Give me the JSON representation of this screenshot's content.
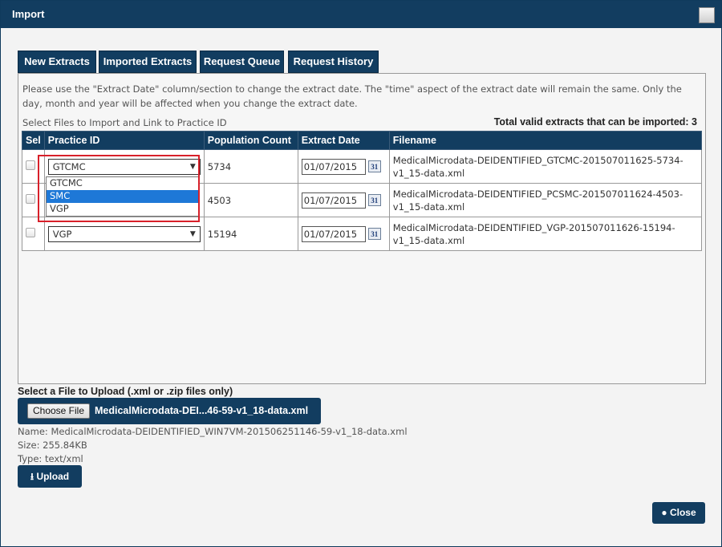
{
  "dialog": {
    "title": "Import"
  },
  "tabs": [
    {
      "label": "New Extracts",
      "active": true
    },
    {
      "label": "Imported Extracts"
    },
    {
      "label": "Request Queue"
    },
    {
      "label": "Request History"
    }
  ],
  "note": "Please use the \"Extract Date\" column/section to change the extract date. The \"time\" aspect of the extract date will remain the same. Only the day, month and year will be affected when you change the extract date.",
  "select_label": "Select Files to Import and Link to Practice ID",
  "total_valid": "Total valid extracts that can be imported: 3",
  "table": {
    "headers": [
      "Sel",
      "Practice ID",
      "Population Count",
      "Extract Date",
      "Filename"
    ],
    "rows": [
      {
        "practice": "GTCMC",
        "population": "5734",
        "date": "01/07/2015",
        "filename": "MedicalMicrodata-DEIDENTIFIED_GTCMC-201507011625-5734-v1_15-data.xml"
      },
      {
        "practice": "",
        "population": "4503",
        "date": "01/07/2015",
        "filename": "MedicalMicrodata-DEIDENTIFIED_PCSMC-201507011624-4503-v1_15-data.xml"
      },
      {
        "practice": "VGP",
        "population": "15194",
        "date": "01/07/2015",
        "filename": "MedicalMicrodata-DEIDENTIFIED_VGP-201507011626-15194-v1_15-data.xml"
      }
    ]
  },
  "dropdown": {
    "options": [
      "GTCMC",
      "SMC",
      "VGP"
    ],
    "highlighted": "SMC"
  },
  "upload": {
    "label": "Select a File to Upload (.xml or .zip files only)",
    "choose_label": "Choose File",
    "chosen_file": "MedicalMicrodata-DEI...46-59-v1_18-data.xml",
    "name": "Name: MedicalMicrodata-DEIDENTIFIED_WIN7VM-201506251146-59-v1_18-data.xml",
    "size": "Size: 255.84KB",
    "type": "Type: text/xml",
    "upload_label": "Upload"
  },
  "close_label": "Close",
  "colors": {
    "primary": "#123d60",
    "highlight": "#1e78d7",
    "annotation": "#d8202a"
  }
}
